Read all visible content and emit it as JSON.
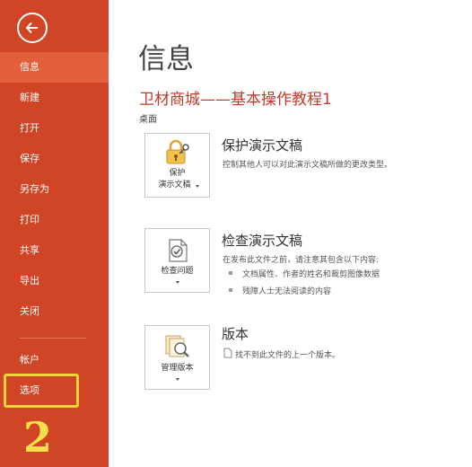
{
  "sidebar": {
    "items": [
      {
        "label": "信息"
      },
      {
        "label": "新建"
      },
      {
        "label": "打开"
      },
      {
        "label": "保存"
      },
      {
        "label": "另存为"
      },
      {
        "label": "打印"
      },
      {
        "label": "共享"
      },
      {
        "label": "导出"
      },
      {
        "label": "关闭"
      },
      {
        "label": "帐户"
      },
      {
        "label": "选项"
      }
    ],
    "active_index": 0,
    "step_number": "2"
  },
  "main": {
    "title": "信息",
    "doc_title": "卫材商城——基本操作教程1",
    "doc_location": "桌面",
    "protect": {
      "button_line1": "保护",
      "button_line2": "演示文稿",
      "title": "保护演示文稿",
      "description": "控制其他人可以对此演示文稿所做的更改类型。"
    },
    "inspect": {
      "button_label": "检查问题",
      "title": "检查演示文稿",
      "description": "在发布此文件之前，请注意其包含以下内容:",
      "items": [
        "文档属性、作者的姓名和裁剪图像数据",
        "残障人士无法阅读的内容"
      ]
    },
    "versions": {
      "button_label": "管理版本",
      "title": "版本",
      "description": "找不到此文件的上一个版本。"
    }
  },
  "colors": {
    "sidebar": "#d04525",
    "sidebar_active": "#e25f3b",
    "doc_title": "#c0392b",
    "highlight": "#f0d23a"
  }
}
